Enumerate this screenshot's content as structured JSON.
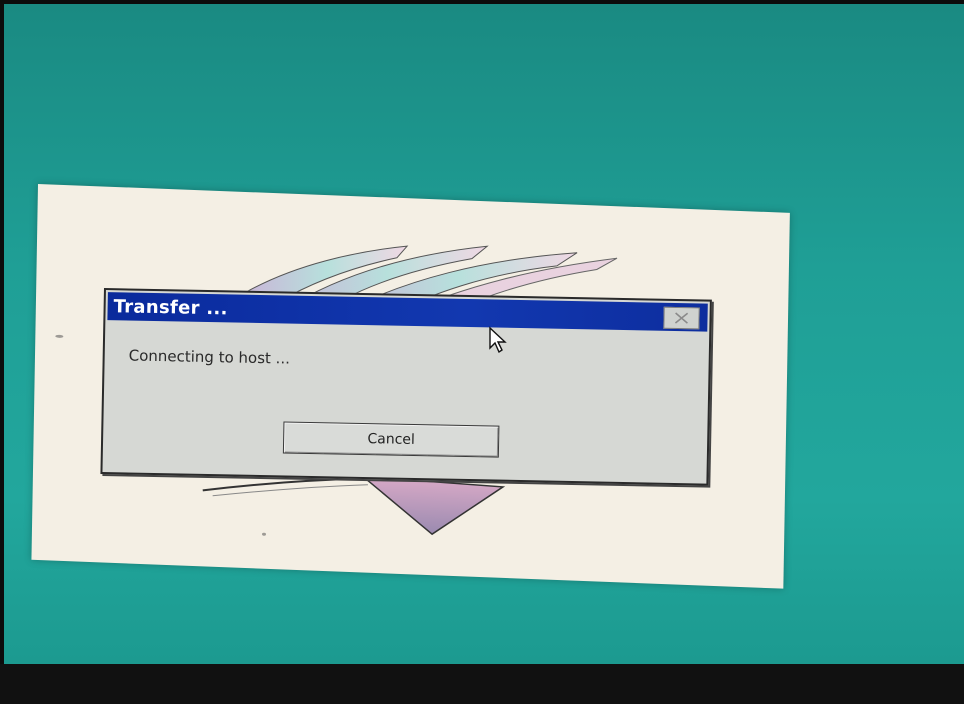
{
  "dialog": {
    "title": "Transfer ...",
    "message": "Connecting to host ...",
    "cancel_label": "Cancel",
    "close_icon": "close-icon"
  },
  "colors": {
    "desktop": "#1f9f96",
    "titlebar": "#1238b0",
    "dialog_body": "#d6d8d4",
    "splash_panel": "#f4efe4"
  },
  "icons": {
    "logo": "swoosh-arrows-logo",
    "cursor": "mouse-cursor-icon"
  }
}
